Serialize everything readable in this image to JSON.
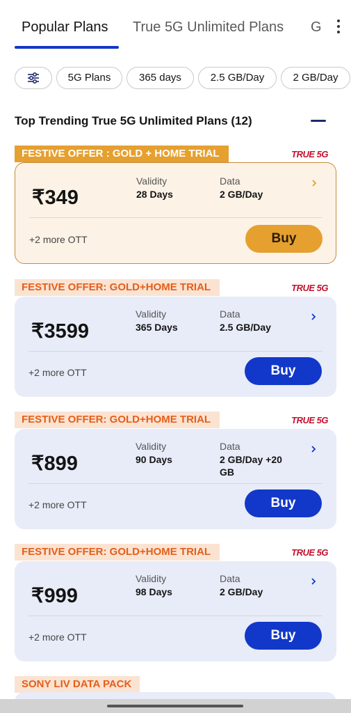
{
  "tabs": [
    {
      "label": "Popular Plans"
    },
    {
      "label": "True 5G Unlimited Plans"
    },
    {
      "label": "G"
    }
  ],
  "filters": [
    "5G Plans",
    "365 days",
    "2.5 GB/Day",
    "2 GB/Day"
  ],
  "section": {
    "title": "Top Trending True 5G Unlimited Plans (12)"
  },
  "badge_text": "TRUE 5G",
  "plans": [
    {
      "offer": "FESTIVE OFFER : GOLD + HOME TRIAL",
      "price": "₹349",
      "validity_label": "Validity",
      "validity": "28 Days",
      "data_label": "Data",
      "data": "2 GB/Day",
      "ott": "+2 more OTT",
      "buy": "Buy"
    },
    {
      "offer": "FESTIVE OFFER: GOLD+HOME TRIAL",
      "price": "₹3599",
      "validity_label": "Validity",
      "validity": "365 Days",
      "data_label": "Data",
      "data": "2.5 GB/Day",
      "ott": "+2 more OTT",
      "buy": "Buy"
    },
    {
      "offer": "FESTIVE OFFER: GOLD+HOME TRIAL",
      "price": "₹899",
      "validity_label": "Validity",
      "validity": "90 Days",
      "data_label": "Data",
      "data": "2 GB/Day +20 GB",
      "ott": "+2 more OTT",
      "buy": "Buy"
    },
    {
      "offer": "FESTIVE OFFER: GOLD+HOME TRIAL",
      "price": "₹999",
      "validity_label": "Validity",
      "validity": "98 Days",
      "data_label": "Data",
      "data": "2 GB/Day",
      "ott": "+2 more OTT",
      "buy": "Buy"
    }
  ],
  "next_offer": "SONY LIV DATA PACK",
  "colors": {
    "accent_blue": "#1138c9",
    "gold": "#e5a030",
    "offer_orange": "#e35f1b",
    "true5g_red": "#c1122f"
  },
  "icons": {
    "filter": "sliders-icon",
    "chevron": "chevron-right-icon",
    "menu": "more-vertical-icon"
  }
}
